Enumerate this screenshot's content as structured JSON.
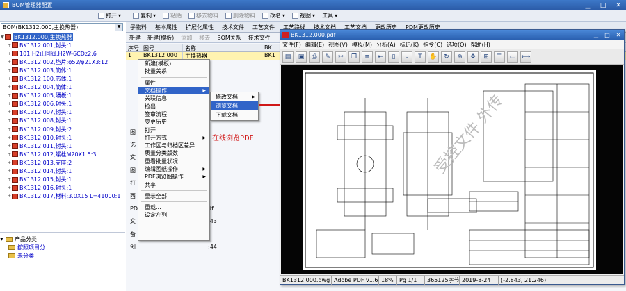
{
  "app": {
    "title": "BOM管理器配置"
  },
  "menubar": {
    "items": [
      "打开",
      "复制",
      "粘贴",
      "移去物料",
      "删除物料",
      "改名",
      "视图",
      "工具"
    ]
  },
  "left": {
    "combo_value": "BOM(BK1312.000,主换热器)",
    "tree_root": "BK1312.000,主换热器",
    "tree_items": [
      "BK1312.001,封头:1",
      "101,H2止回阀,H2W-6CDz2.6",
      "BK1312.002,垫片:φ52/φ21X3:12",
      "BK1312.003,筒体:1",
      "BK1312.100,芯体:1",
      "BK1312.004,筒体:1",
      "BK1312.005,隔板:1",
      "BK1312.006,封头:1",
      "BK1312.007,封头:1",
      "BK1312.008,封头:1",
      "BK1312.009,封头:2",
      "BK1312.010,封头:1",
      "BK1312.011,封头:1",
      "BK1312.012,螺栓M20X1.5:3",
      "BK1312.013,支座:2",
      "BK1312.014,封头:1",
      "BK1312.015,封头:1",
      "BK1312.016,封头:1",
      "BK1312.017,材料:3.0X15 L=41000:1"
    ],
    "cat_root": "产品分类",
    "cat_items": [
      "按照项目分",
      "未分类"
    ]
  },
  "main": {
    "tabs": [
      "子物料",
      "基本属性",
      "扩展化属性",
      "技术文件",
      "工艺文件",
      "工艺路线",
      "技术文档",
      "工艺文档",
      "更改历史",
      "PDM更改历史"
    ],
    "toolbar": [
      "新建",
      "新建(模板)",
      "添加",
      "移去",
      "BOM关系",
      "技术文件"
    ],
    "grid_headers": [
      "序号",
      "图号",
      "名称",
      "",
      "BK"
    ],
    "grid_row": [
      "1",
      "BK1312.000",
      "主换热器",
      "",
      "BK1"
    ],
    "prop_labels": [
      "图",
      "选",
      "文",
      "图",
      "打",
      "西",
      "PDF",
      "文",
      "备",
      "创"
    ],
    "prop_values": [
      "",
      "",
      "",
      "",
      "",
      "",
      "df",
      ":43",
      "",
      ":44"
    ]
  },
  "context_menu": {
    "items": [
      "新建(模板)",
      "批量关系",
      "属性",
      "文档操作",
      "关联信息",
      "检出",
      "签审流程",
      "变更历史",
      "打开",
      "打开方式",
      "工作区与归档区差异",
      "质量分类版数",
      "重看批量状况",
      "编辑图纸操作",
      "PDF浏览图操作",
      "共享",
      "显示全部",
      "重载...",
      "设定左列"
    ],
    "highlighted": "文档操作",
    "submenu": [
      "修改文档",
      "浏览文档",
      "下载文档"
    ],
    "submenu_highlighted": "浏览文档"
  },
  "annotation": "在线浏览PDF",
  "pdf": {
    "title": "BK1312.000.pdf",
    "menu": [
      "文件(F)",
      "编辑(E)",
      "视图(V)",
      "模拟(M)",
      "分析(A)",
      "标记(K)",
      "指令(C)",
      "选项(O)",
      "帮助(H)"
    ],
    "status": [
      "BK1312.000.dwg",
      "Adobe PDF v1.6",
      "18%",
      "Pg 1/1",
      "365125字节",
      "2019-8-24",
      "(-2.843, 21.246)"
    ],
    "watermark": "受控文件 外传"
  },
  "colors": {
    "titlebar": "#2a5aa6",
    "selection": "#3164c8",
    "annotation": "#d01818",
    "row_highlight": "#fff3b0"
  }
}
